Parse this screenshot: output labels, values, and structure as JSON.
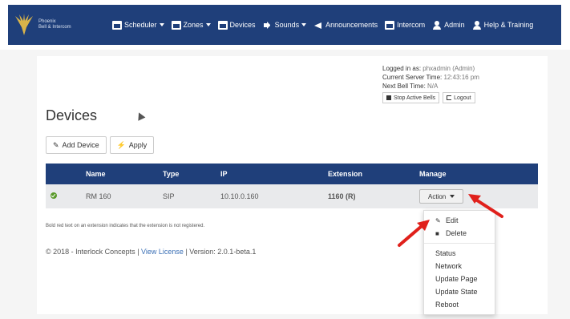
{
  "nav": {
    "brand_line1": "Phoenix",
    "brand_line2": "Bell & Intercom",
    "items": [
      {
        "label": "Scheduler",
        "icon": "calendar-icon",
        "dropdown": true
      },
      {
        "label": "Zones",
        "icon": "zones-icon",
        "dropdown": true
      },
      {
        "label": "Devices",
        "icon": "devices-icon",
        "dropdown": false
      },
      {
        "label": "Sounds",
        "icon": "speaker-icon",
        "dropdown": true
      },
      {
        "label": "Announcements",
        "icon": "megaphone-icon",
        "dropdown": false
      },
      {
        "label": "Intercom",
        "icon": "intercom-icon",
        "dropdown": false
      },
      {
        "label": "Admin",
        "icon": "admin-icon",
        "dropdown": false
      },
      {
        "label": "Help & Training",
        "icon": "help-icon",
        "dropdown": false
      }
    ]
  },
  "status": {
    "logged_in_label": "Logged in as:",
    "logged_in_value": "phxadmin (Admin)",
    "server_time_label": "Current Server Time:",
    "server_time_value": "12:43:16 pm",
    "next_bell_label": "Next Bell Time:",
    "next_bell_value": "N/A",
    "stop_bells_label": "Stop Active Bells",
    "logout_label": "Logout"
  },
  "page": {
    "title": "Devices",
    "add_device_label": "Add Device",
    "apply_label": "Apply"
  },
  "table": {
    "headers": [
      "Name",
      "Type",
      "IP",
      "Extension",
      "Manage"
    ],
    "rows": [
      {
        "name": "RM 160",
        "type": "SIP",
        "ip": "10.10.0.160",
        "extension": "1160 (R)",
        "action": "Action"
      }
    ]
  },
  "note": "Bold red text on an extension indicates that the extension is not registered.",
  "footer": {
    "prefix": "© 2018 - Interlock Concepts |",
    "license_link": "View License",
    "version": "| Version: 2.0.1-beta.1"
  },
  "dropdown": {
    "items_top": [
      {
        "label": "Edit",
        "icon": "pencil-icon"
      },
      {
        "label": "Delete",
        "icon": "trash-icon"
      }
    ],
    "items_bottom": [
      "Status",
      "Network",
      "Update Page",
      "Update State",
      "Reboot"
    ]
  },
  "colors": {
    "navbar": "#1f3f7a",
    "table_header": "#1f3f7a",
    "link": "#3a6fb5",
    "extension": "#3d7a12",
    "annotation_arrow": "#e0201b"
  }
}
